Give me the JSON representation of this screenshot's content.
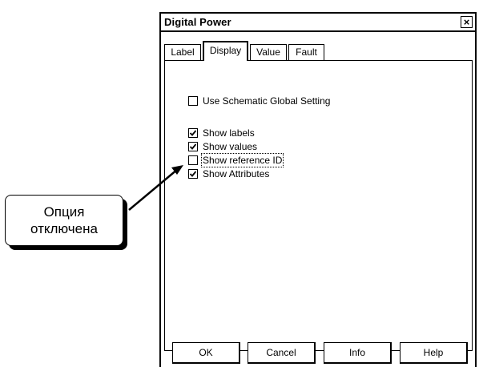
{
  "dialog": {
    "title": "Digital Power",
    "close_glyph": "×"
  },
  "tabs": [
    {
      "label": "Label",
      "active": false
    },
    {
      "label": "Display",
      "active": true
    },
    {
      "label": "Value",
      "active": false
    },
    {
      "label": "Fault",
      "active": false
    }
  ],
  "options": [
    {
      "label": "Use Schematic Global Setting",
      "checked": false
    },
    {
      "label": "Show labels",
      "checked": true
    },
    {
      "label": "Show values",
      "checked": true
    },
    {
      "label": "Show reference ID",
      "checked": false
    },
    {
      "label": "Show Attributes",
      "checked": true
    }
  ],
  "buttons": {
    "ok": "OK",
    "cancel": "Cancel",
    "info": "Info",
    "help": "Help"
  },
  "callout": {
    "line1": "Опция",
    "line2": "отключена"
  }
}
